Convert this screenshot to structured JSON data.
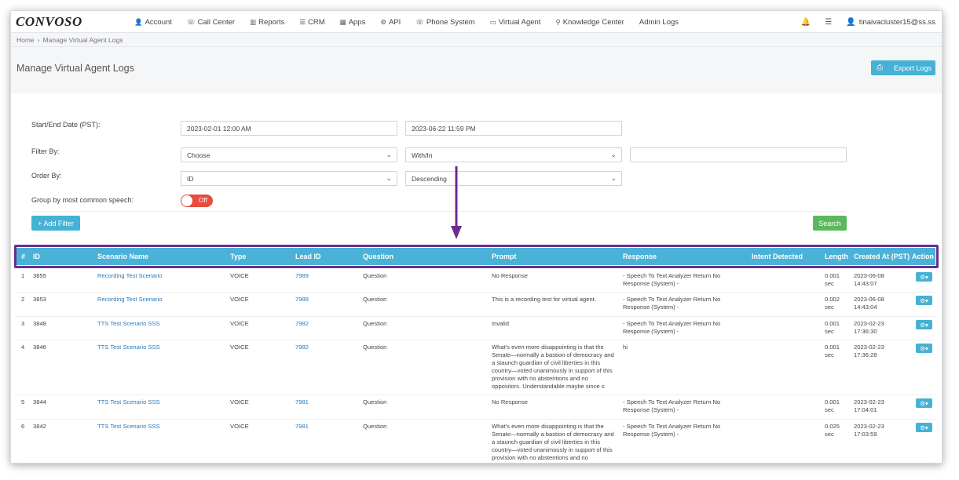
{
  "app": {
    "logo": "CONVOSO"
  },
  "nav": {
    "items": [
      {
        "icon": "👤",
        "label": "Account"
      },
      {
        "icon": "☏",
        "label": "Call Center"
      },
      {
        "icon": "▥",
        "label": "Reports"
      },
      {
        "icon": "☰",
        "label": "CRM"
      },
      {
        "icon": "▦",
        "label": "Apps"
      },
      {
        "icon": "⚙",
        "label": "API"
      },
      {
        "icon": "☏",
        "label": "Phone System"
      },
      {
        "icon": "▭",
        "label": "Virtual Agent"
      },
      {
        "icon": "⚲",
        "label": "Knowledge Center"
      },
      {
        "icon": "",
        "label": "Admin Logs"
      }
    ],
    "user": "tinaivacluster15@ss.ss"
  },
  "breadcrumb": {
    "home": "Home",
    "sep": "›",
    "current": "Manage Virtual Agent Logs"
  },
  "page": {
    "title": "Manage Virtual Agent Logs",
    "export_label": "Export Logs"
  },
  "filters": {
    "date_label": "Start/End Date (PST):",
    "start_date": "2023-02-01 12:00 AM",
    "end_date": "2023-06-22 11:59 PM",
    "filter_label": "Filter By:",
    "filter_field": "Choose",
    "filter_op": "With/In",
    "filter_value": "",
    "order_label": "Order By:",
    "order_field": "ID",
    "order_dir": "Descending",
    "group_label": "Group by most common speech:",
    "group_toggle": "Off",
    "add_filter_label": "+ Add Filter",
    "search_label": "Search"
  },
  "table": {
    "headers": [
      "#",
      "ID",
      "Scenario Name",
      "Type",
      "Lead ID",
      "Question",
      "Prompt",
      "Response",
      "Intent Detected",
      "Length",
      "Created At (PST)",
      "Action"
    ],
    "rows": [
      {
        "num": "1",
        "id": "3855",
        "scenario": "Recording Test Scenario",
        "type": "VOICE",
        "lead": "7989",
        "question": "Question",
        "prompt": "No Response",
        "response": "- Speech To Text Analyzer Return No Response (System) -",
        "intent": "",
        "length": "0.001 sec",
        "created": "2023-06-08 14:43:07"
      },
      {
        "num": "2",
        "id": "3853",
        "scenario": "Recording Test Scenario",
        "type": "VOICE",
        "lead": "7989",
        "question": "Question",
        "prompt": "This is a recording test for virtual agent.",
        "response": "- Speech To Text Analyzer Return No Response (System) -",
        "intent": "",
        "length": "0.002 sec",
        "created": "2023-06-08 14:43:04"
      },
      {
        "num": "3",
        "id": "3848",
        "scenario": "TTS Test Scenario SSS",
        "type": "VOICE",
        "lead": "7982",
        "question": "Question",
        "prompt": "Invalid",
        "response": "- Speech To Text Analyzer Return No Response (System) -",
        "intent": "",
        "length": "0.001 sec",
        "created": "2023-02-23 17:36:30"
      },
      {
        "num": "4",
        "id": "3846",
        "scenario": "TTS Test Scenario SSS",
        "type": "VOICE",
        "lead": "7982",
        "question": "Question",
        "prompt": "What's even more disappointing is that the Senate—normally a bastion of democracy and a staunch guardian of civil liberties in this country—voted unanimously in support of this provision with no abstentions and no oppositors. Understandable maybe since s",
        "response": "hi",
        "intent": "",
        "length": "0.001 sec",
        "created": "2023-02-23 17:36:28"
      },
      {
        "num": "5",
        "id": "3844",
        "scenario": "TTS Test Scenario SSS",
        "type": "VOICE",
        "lead": "7981",
        "question": "Question",
        "prompt": "No Response",
        "response": "- Speech To Text Analyzer Return No Response (System) -",
        "intent": "",
        "length": "0.001 sec",
        "created": "2023-02-23 17:04:01"
      },
      {
        "num": "6",
        "id": "3842",
        "scenario": "TTS Test Scenario SSS",
        "type": "VOICE",
        "lead": "7981",
        "question": "Question",
        "prompt": "What's even more disappointing is that the Senate—normally a bastion of democracy and a staunch guardian of civil liberties in this country—voted unanimously in support of this provision with no abstentions and no oppositors. Understandable maybe since s",
        "response": "- Speech To Text Analyzer Return No Response (System) -",
        "intent": "",
        "length": "0.025 sec",
        "created": "2023-02-23 17:03:59"
      }
    ],
    "action_icon": "⚙▾"
  },
  "colors": {
    "accent": "#45b1d5",
    "header": "#4ab2d7",
    "highlight": "#6b2e8f",
    "search": "#5cb85c",
    "toggle_off": "#e74c3c"
  }
}
